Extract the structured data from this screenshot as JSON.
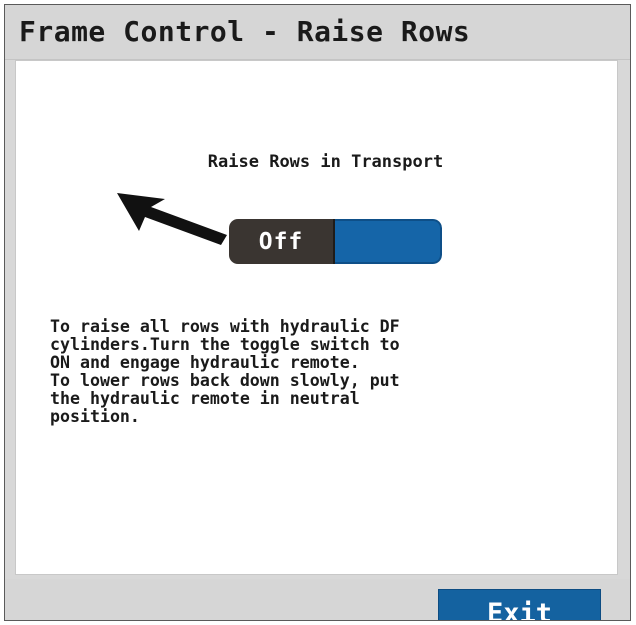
{
  "window": {
    "title": "Frame Control - Raise Rows"
  },
  "toggle": {
    "heading": "Raise Rows in Transport",
    "state_label": "Off",
    "off_color": "#3a3531",
    "on_color": "#1565a8"
  },
  "instructions": {
    "lines": [
      "To raise all rows with hydraulic DF",
      "cylinders.Turn the toggle switch to",
      "ON and engage hydraulic remote.",
      "To lower rows back down slowly, put",
      "the hydraulic remote in neutral",
      "position."
    ]
  },
  "footer": {
    "exit_label": "Exit",
    "exit_color": "#1462a0"
  },
  "icons": {
    "pointer": "arrow-icon"
  }
}
